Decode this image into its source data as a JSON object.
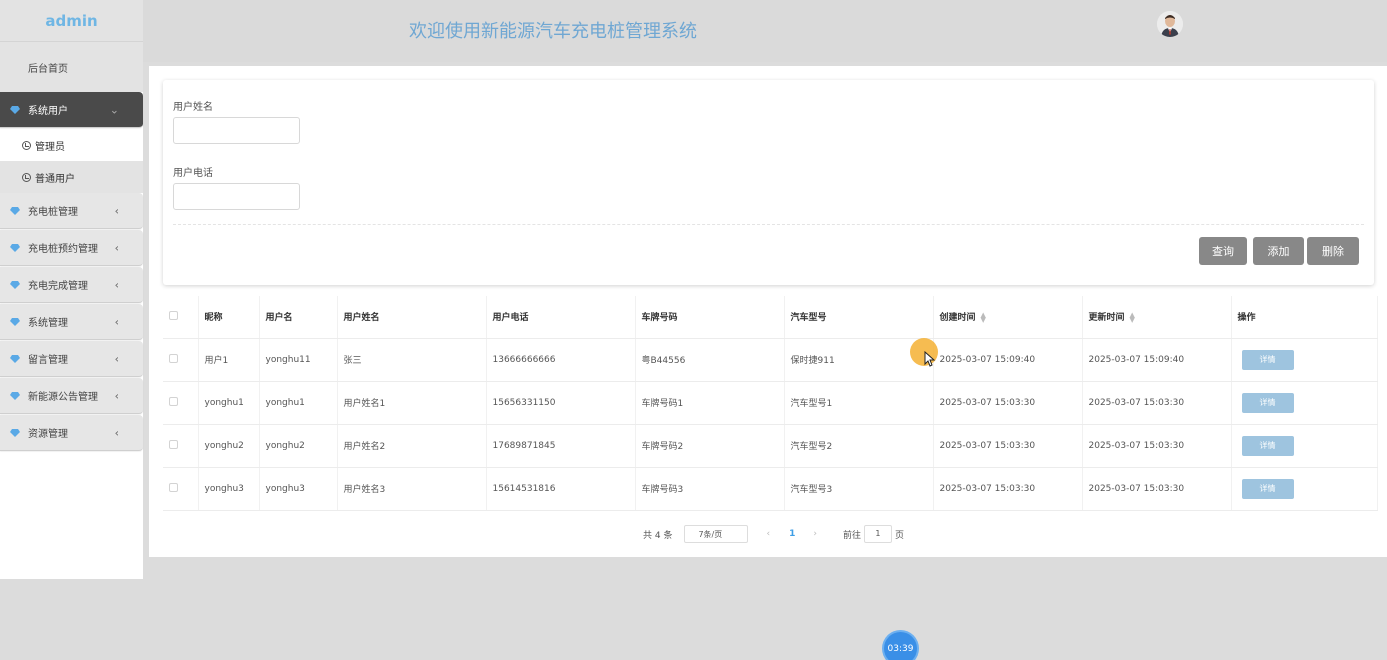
{
  "sidebar": {
    "logo": "admin",
    "home": "后台首页",
    "items": [
      {
        "label": "系统用户",
        "active": true
      },
      {
        "label": "充电桩管理"
      },
      {
        "label": "充电桩预约管理"
      },
      {
        "label": "充电完成管理"
      },
      {
        "label": "系统管理"
      },
      {
        "label": "留言管理"
      },
      {
        "label": "新能源公告管理"
      },
      {
        "label": "资源管理"
      }
    ],
    "sub_items": [
      {
        "label": "管理员"
      },
      {
        "label": "普通用户"
      }
    ],
    "chevron": "‹",
    "gem_color": "#5aa9e6"
  },
  "header": {
    "title": "欢迎使用新能源汽车充电桩管理系统",
    "avatar_icon": "user-avatar"
  },
  "search": {
    "name_label": "用户姓名",
    "phone_label": "用户电话",
    "name_value": "",
    "phone_value": "",
    "query_label": "查询",
    "add_label": "添加",
    "delete_label": "删除"
  },
  "table": {
    "columns": [
      "昵称",
      "用户名",
      "用户姓名",
      "用户电话",
      "车牌号码",
      "汽车型号",
      "创建时间",
      "更新时间",
      "操作"
    ],
    "detail_label": "详情",
    "rows": [
      [
        "用户1",
        "yonghu11",
        "张三",
        "13666666666",
        "粤B44556",
        "保时捷911",
        "2025-03-07 15:09:40",
        "2025-03-07 15:09:40"
      ],
      [
        "yonghu1",
        "yonghu1",
        "用户姓名1",
        "15656331150",
        "车牌号码1",
        "汽车型号1",
        "2025-03-07 15:03:30",
        "2025-03-07 15:03:30"
      ],
      [
        "yonghu2",
        "yonghu2",
        "用户姓名2",
        "17689871845",
        "车牌号码2",
        "汽车型号2",
        "2025-03-07 15:03:30",
        "2025-03-07 15:03:30"
      ],
      [
        "yonghu3",
        "yonghu3",
        "用户姓名3",
        "15614531816",
        "车牌号码3",
        "汽车型号3",
        "2025-03-07 15:03:30",
        "2025-03-07 15:03:30"
      ]
    ]
  },
  "pager": {
    "total": "共 4 条",
    "page_size": "7条/页",
    "prev": "‹",
    "next": "›",
    "current_page": "1",
    "goto_label": "前往",
    "goto_value": "1",
    "page_unit": "页"
  },
  "recorder": {
    "timer": "03:39"
  }
}
